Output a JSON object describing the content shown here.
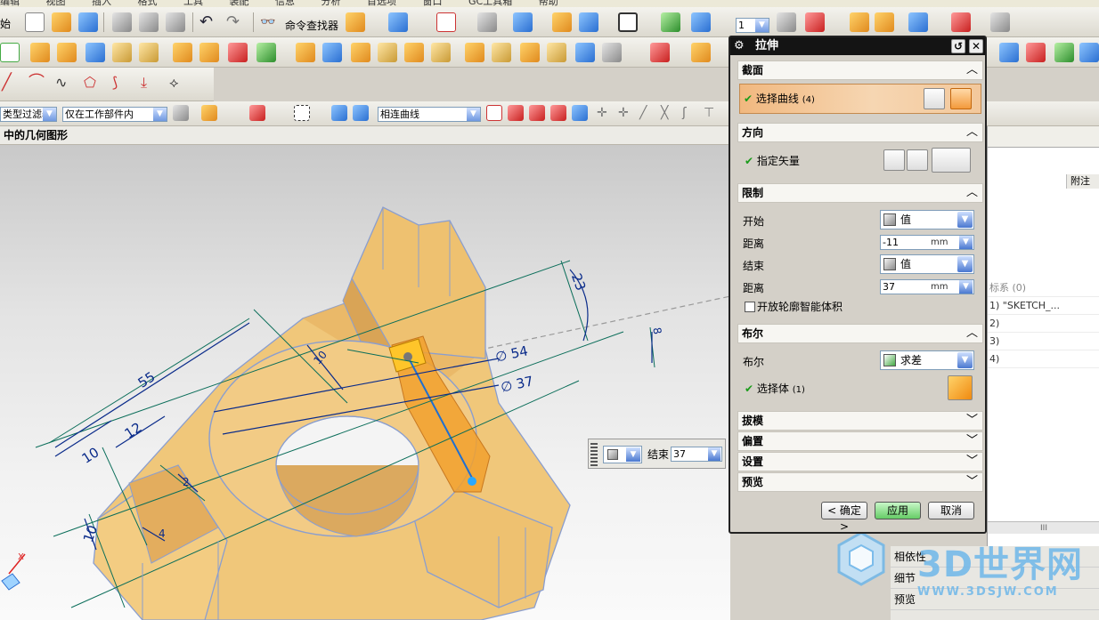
{
  "menu": [
    "编辑",
    "视图",
    "插入",
    "格式",
    "工具",
    "装配",
    "信息",
    "分析",
    "首选项",
    "窗口",
    "GC工具箱",
    "帮助"
  ],
  "toolbar": {
    "start_label": "始",
    "command_finder": "命令查找器",
    "layer_value": "1"
  },
  "selection": {
    "filter": "类型过滤器",
    "scope": "仅在工作部件内",
    "curve_rule": "相连曲线"
  },
  "nav_label": "中的几何图形",
  "right_panel": {
    "column_note": "附注",
    "rows": [
      "标系 (0)",
      "1) \"SKETCH_...",
      "2)",
      "3)",
      "4)"
    ],
    "tabs": [
      "相依性",
      "细节",
      "预览"
    ]
  },
  "dialog": {
    "title": "拉伸",
    "sections": {
      "section": "截面",
      "direction": "方向",
      "limits": "限制",
      "boolean": "布尔",
      "draft": "拔模",
      "offset": "偏置",
      "settings": "设置",
      "preview": "预览"
    },
    "select_curve": "选择曲线",
    "select_curve_count": "(4)",
    "specify_vector": "指定矢量",
    "start_label": "开始",
    "start_value": "值",
    "distance_label_1": "距离",
    "distance_1": "-11",
    "unit_1": "mm",
    "end_label": "结束",
    "end_value": "值",
    "distance_label_2": "距离",
    "distance_2": "37",
    "unit_2": "mm",
    "open_profile": "开放轮廓智能体积",
    "boolean_label": "布尔",
    "boolean_value": "求差",
    "select_body": "选择体",
    "select_body_count": "(1)",
    "ok": "< 确定 >",
    "apply": "应用",
    "cancel": "取消"
  },
  "floating": {
    "label": "结束",
    "value": "37"
  },
  "dimensions": [
    "55",
    "12",
    "10",
    "10",
    "4",
    "2",
    "10",
    "∅ 54",
    "∅ 37",
    "23",
    "8"
  ],
  "watermark": {
    "text": "3D世界网",
    "url": "WWW.3DSJW.COM"
  },
  "colors": {
    "part": "#f0c77a",
    "part_edge": "#8a9ecf",
    "dialog_title": "#141414",
    "apply_button": "#8de08d",
    "dimension": "#0a2b8a",
    "axis_line": "#0b6e5a"
  }
}
